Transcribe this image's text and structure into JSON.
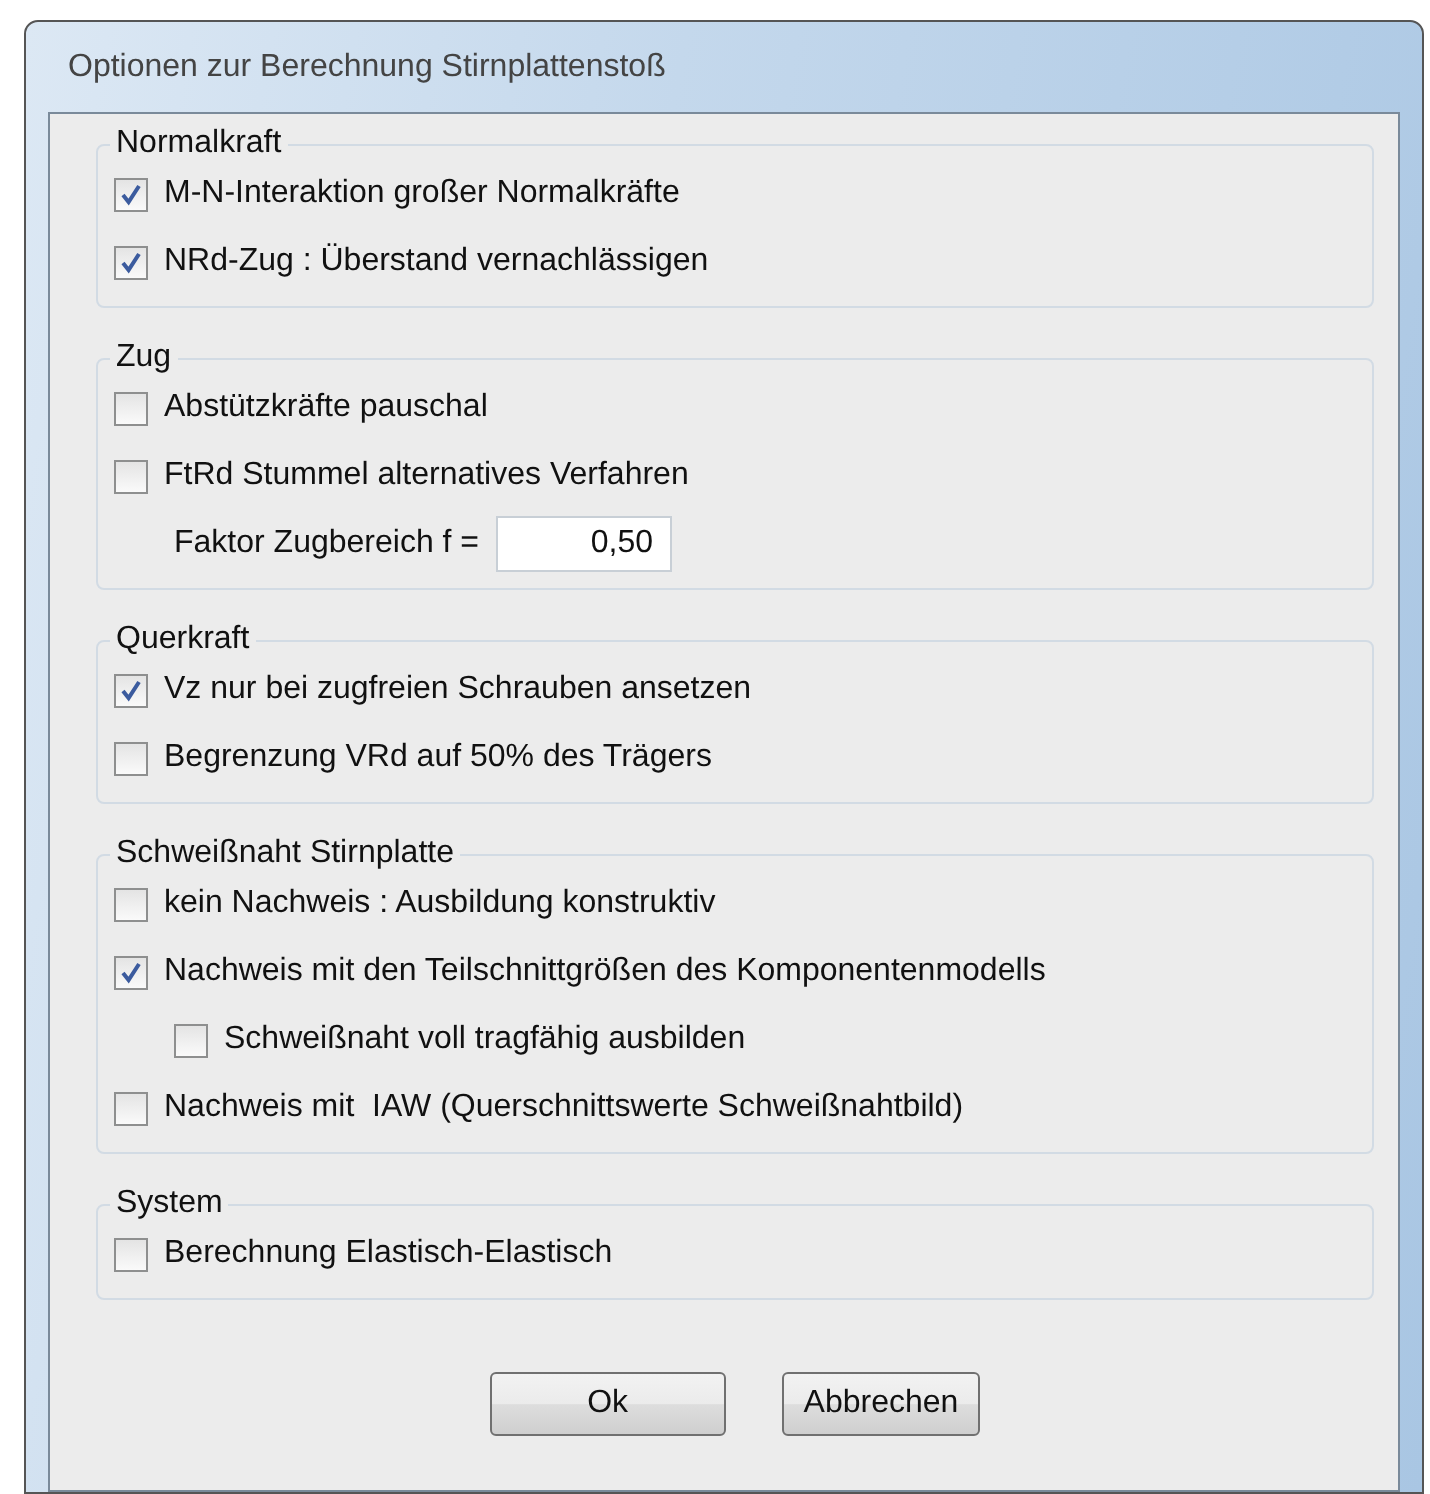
{
  "window": {
    "title": "Optionen zur Berechnung Stirnplattenstoß"
  },
  "groups": [
    {
      "title": "Normalkraft",
      "items": [
        {
          "kind": "checkbox",
          "label": "M-N-Interaktion großer Normalkräfte",
          "checked": true
        },
        {
          "kind": "checkbox",
          "label": "NRd-Zug : Überstand vernachlässigen",
          "checked": true
        }
      ]
    },
    {
      "title": "Zug",
      "items": [
        {
          "kind": "checkbox",
          "label": "Abstützkräfte pauschal",
          "checked": false
        },
        {
          "kind": "checkbox",
          "label": "FtRd Stummel alternatives Verfahren",
          "checked": false
        },
        {
          "kind": "field",
          "label": "Faktor Zugbereich f =",
          "value": "0,50"
        }
      ]
    },
    {
      "title": "Querkraft",
      "items": [
        {
          "kind": "checkbox",
          "label": "Vz nur bei zugfreien Schrauben ansetzen",
          "checked": true
        },
        {
          "kind": "checkbox",
          "label": "Begrenzung VRd auf 50% des Trägers",
          "checked": false
        }
      ]
    },
    {
      "title": "Schweißnaht Stirnplatte",
      "items": [
        {
          "kind": "checkbox",
          "label": "kein Nachweis : Ausbildung konstruktiv",
          "checked": false
        },
        {
          "kind": "checkbox",
          "label": "Nachweis mit den Teilschnittgrößen des Komponentenmodells",
          "checked": true,
          "children": [
            {
              "kind": "checkbox",
              "label": "Schweißnaht voll tragfähig ausbilden",
              "checked": false
            }
          ]
        },
        {
          "kind": "checkbox",
          "label": "Nachweis mit  IAW (Querschnittswerte Schweißnahtbild)",
          "checked": false
        }
      ]
    },
    {
      "title": "System",
      "items": [
        {
          "kind": "checkbox",
          "label": "Berechnung Elastisch-Elastisch",
          "checked": false
        }
      ]
    }
  ],
  "buttons": [
    "Ok",
    "Abbrechen"
  ]
}
